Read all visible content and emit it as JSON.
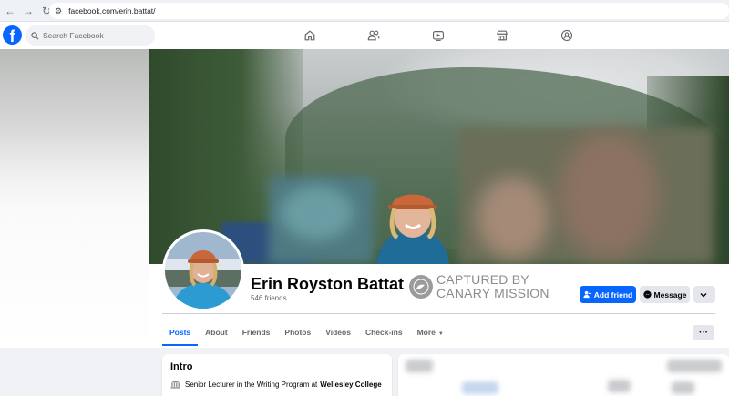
{
  "browser": {
    "url": "facebook.com/erin.battat/"
  },
  "header": {
    "logo": "f",
    "search_placeholder": "Search Facebook",
    "nav_icons": [
      "home-icon",
      "friends-icon",
      "watch-icon",
      "marketplace-icon",
      "groups-icon"
    ]
  },
  "profile": {
    "name": "Erin Royston Battat",
    "friends": "546 friends"
  },
  "watermark": {
    "line1": "CAPTURED BY",
    "line2": "CANARY MISSION"
  },
  "actions": {
    "add_friend": "Add friend",
    "message": "Message"
  },
  "tabs": [
    {
      "label": "Posts",
      "active": true
    },
    {
      "label": "About",
      "active": false
    },
    {
      "label": "Friends",
      "active": false
    },
    {
      "label": "Photos",
      "active": false
    },
    {
      "label": "Videos",
      "active": false
    },
    {
      "label": "Check-ins",
      "active": false
    },
    {
      "label": "More",
      "active": false
    }
  ],
  "tabs_overflow": "···",
  "intro": {
    "title": "Intro",
    "job_prefix": "Senior Lecturer in the Writing Program at",
    "job_org": "Wellesley College"
  },
  "colors": {
    "brand": "#0866ff",
    "page_bg": "#f0f2f5",
    "secondary_btn": "#e4e6eb"
  }
}
